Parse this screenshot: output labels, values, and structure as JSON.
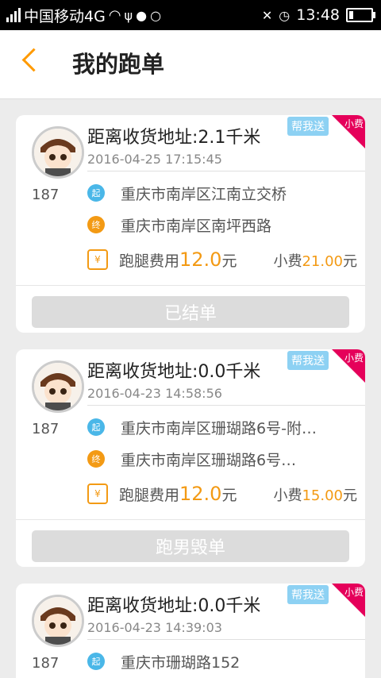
{
  "status_bar": {
    "carrier": "中国移动4G",
    "time": "13:48"
  },
  "header": {
    "title": "我的跑单"
  },
  "orders": [
    {
      "user_id": "187",
      "distance": "距离收货地址:2.1千米",
      "datetime": "2016-04-25 17:15:45",
      "start_label": "起",
      "start_address": "重庆市南岸区江南立交桥",
      "end_label": "终",
      "end_address": "重庆市南岸区南坪西路",
      "fee_icon": "¥",
      "fee_label": "跑腿费用",
      "fee_amount": "12.0",
      "fee_unit": "元",
      "tip_label": "小费",
      "tip_amount": "21.00",
      "tip_unit": "元",
      "tag": "帮我送",
      "corner": "小费",
      "status_button": "已结单"
    },
    {
      "user_id": "187",
      "distance": "距离收货地址:0.0千米",
      "datetime": "2016-04-23 14:58:56",
      "start_label": "起",
      "start_address": "重庆市南岸区珊瑚路6号-附…",
      "end_label": "终",
      "end_address": "重庆市南岸区珊瑚路6号…",
      "fee_icon": "¥",
      "fee_label": "跑腿费用",
      "fee_amount": "12.0",
      "fee_unit": "元",
      "tip_label": "小费",
      "tip_amount": "15.00",
      "tip_unit": "元",
      "tag": "帮我送",
      "corner": "小费",
      "status_button": "跑男毁单"
    },
    {
      "user_id": "187",
      "distance": "距离收货地址:0.0千米",
      "datetime": "2016-04-23 14:39:03",
      "start_label": "起",
      "start_address": "重庆市珊瑚路152",
      "tag": "帮我送",
      "corner": "小费"
    }
  ],
  "colors": {
    "accent": "#f39a14",
    "start": "#4ab7e8",
    "corner": "#e5005a",
    "tag": "#8dd1f3"
  }
}
